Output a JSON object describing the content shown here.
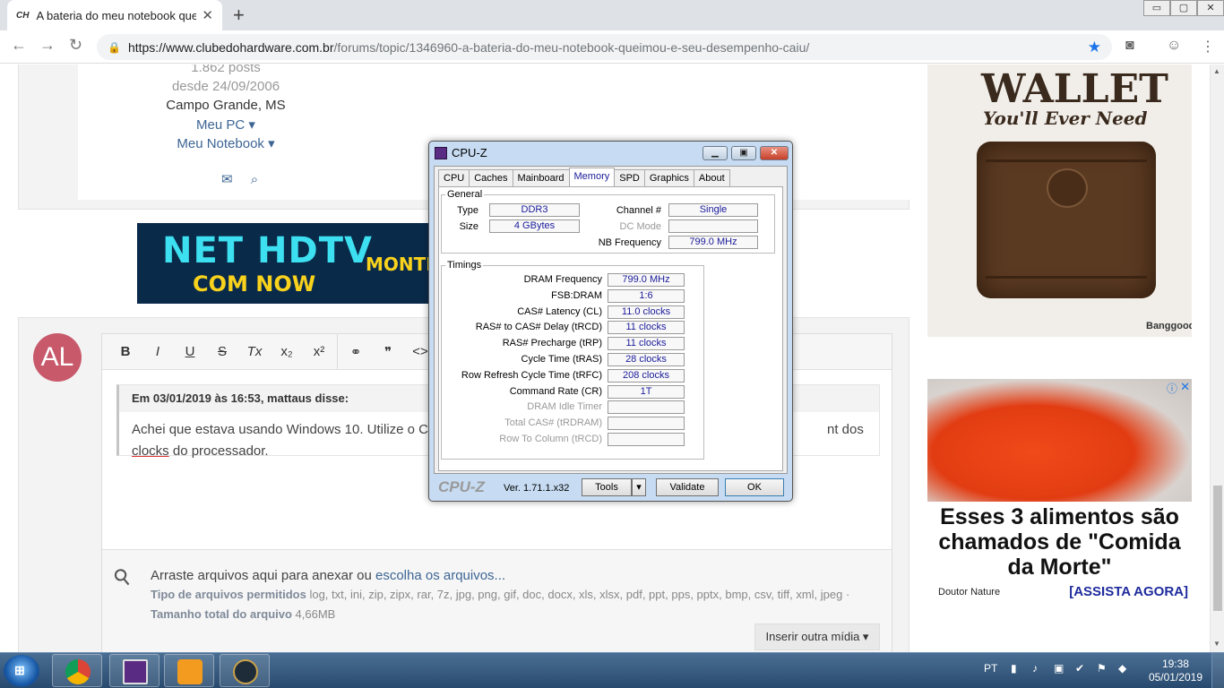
{
  "browser": {
    "tab_title": "A bateria do meu notebook quei",
    "tab_favicon": "CH",
    "tab_close": "✕",
    "new_tab": "+",
    "url_host": "https://www.clubedohardware.com.br",
    "url_path": "/forums/topic/1346960-a-bateria-do-meu-notebook-queimou-e-seu-desempenho-caiu/",
    "window_controls": [
      "▭",
      "▢",
      "✕"
    ]
  },
  "profile": {
    "posts": "1.862 posts",
    "since": "desde 24/09/2006",
    "location": "Campo Grande, MS",
    "my_pc": "Meu PC ▾",
    "my_notebook": "Meu Notebook ▾"
  },
  "banner": {
    "line1": "NET HDTV",
    "line2": "COM NOW",
    "line3": "MONTI"
  },
  "reply": {
    "avatar_initials": "AL",
    "toolbar": [
      "B",
      "I",
      "U",
      "S",
      "Tx",
      "x₂",
      "x²",
      "⚭",
      "❞",
      "<>"
    ],
    "quote_header": "Em 03/01/2019 às 16:53, mattaus disse:",
    "quote_text_start": "Achei que estava usando Windows 10. Utilize o C",
    "quote_text_end": "nt dos",
    "quote_word_clocks": "clocks",
    "quote_text_line2": " do processador.",
    "attach_text": "Arraste arquivos aqui para anexar ou ",
    "attach_link": "escolha os arquivos...",
    "types_label": "Tipo de arquivos permitidos",
    "types_value": " log, txt, ini, zip, zipx, rar, 7z, jpg, png, gif, doc, docx, xls, xlsx, pdf, ppt, pps, pptx, bmp, csv, tiff, xml, jpeg ·",
    "size_label": "Tamanho total do arquivo",
    "size_value": " 4,66MB",
    "more_media": "Inserir outra mídia ▾"
  },
  "ads": {
    "wallet_line1": "WALLET",
    "wallet_line2": "You'll Ever Need",
    "wallet_brand": "Banggood",
    "food_headline": "Esses 3 alimentos são chamados de \"Comida da Morte\"",
    "food_source": "Doutor Nature",
    "food_cta": "[ASSISTA AGORA]"
  },
  "cpuz": {
    "title": "CPU-Z",
    "tabs": [
      "CPU",
      "Caches",
      "Mainboard",
      "Memory",
      "SPD",
      "Graphics",
      "About"
    ],
    "active_tab": "Memory",
    "general_legend": "General",
    "type_label": "Type",
    "type_value": "DDR3",
    "size_label": "Size",
    "size_value": "4 GBytes",
    "channel_label": "Channel #",
    "channel_value": "Single",
    "dcmode_label": "DC Mode",
    "dcmode_value": "",
    "nbfreq_label": "NB Frequency",
    "nbfreq_value": "799.0 MHz",
    "timings_legend": "Timings",
    "timings": [
      {
        "label": "DRAM Frequency",
        "value": "799.0 MHz",
        "enabled": true
      },
      {
        "label": "FSB:DRAM",
        "value": "1:6",
        "enabled": true
      },
      {
        "label": "CAS# Latency (CL)",
        "value": "11.0 clocks",
        "enabled": true
      },
      {
        "label": "RAS# to CAS# Delay (tRCD)",
        "value": "11 clocks",
        "enabled": true
      },
      {
        "label": "RAS# Precharge (tRP)",
        "value": "11 clocks",
        "enabled": true
      },
      {
        "label": "Cycle Time (tRAS)",
        "value": "28 clocks",
        "enabled": true
      },
      {
        "label": "Row Refresh Cycle Time (tRFC)",
        "value": "208 clocks",
        "enabled": true
      },
      {
        "label": "Command Rate (CR)",
        "value": "1T",
        "enabled": true
      },
      {
        "label": "DRAM Idle Timer",
        "value": "",
        "enabled": false
      },
      {
        "label": "Total CAS# (tRDRAM)",
        "value": "",
        "enabled": false
      },
      {
        "label": "Row To Column (tRCD)",
        "value": "",
        "enabled": false
      }
    ],
    "logo": "CPU-Z",
    "version": "Ver. 1.71.1.x32",
    "tools_btn": "Tools",
    "validate_btn": "Validate",
    "ok_btn": "OK"
  },
  "taskbar": {
    "lang": "PT",
    "time": "19:38",
    "date": "05/01/2019"
  }
}
